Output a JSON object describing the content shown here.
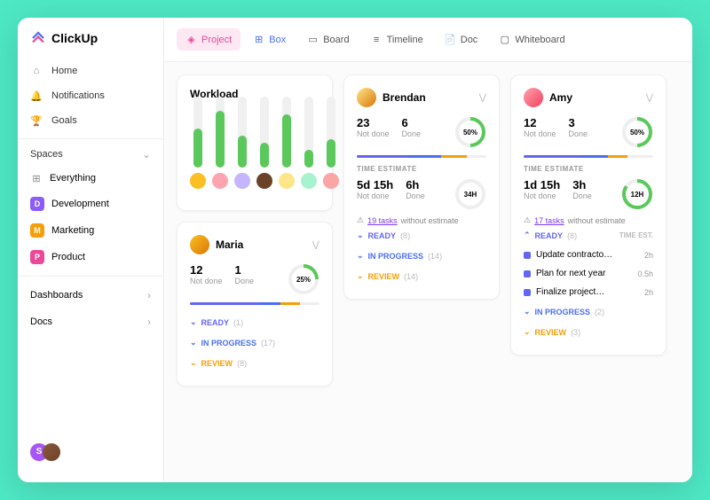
{
  "brand": "ClickUp",
  "sidebar": {
    "nav": [
      {
        "icon": "home",
        "label": "Home"
      },
      {
        "icon": "bell",
        "label": "Notifications"
      },
      {
        "icon": "trophy",
        "label": "Goals"
      }
    ],
    "spaces_label": "Spaces",
    "everything": "Everything",
    "spaces": [
      {
        "letter": "D",
        "color": "#8b5cf6",
        "name": "Development"
      },
      {
        "letter": "M",
        "color": "#f59e0b",
        "name": "Marketing"
      },
      {
        "letter": "P",
        "color": "#ec4899",
        "name": "Product"
      }
    ],
    "dashboards": "Dashboards",
    "docs": "Docs"
  },
  "topbar": {
    "project": "Project",
    "views": [
      {
        "icon": "box",
        "label": "Box",
        "selected": true
      },
      {
        "icon": "board",
        "label": "Board"
      },
      {
        "icon": "timeline",
        "label": "Timeline"
      },
      {
        "icon": "doc",
        "label": "Doc"
      },
      {
        "icon": "whiteboard",
        "label": "Whiteboard"
      }
    ]
  },
  "workload": {
    "title": "Workload",
    "bars": [
      55,
      80,
      45,
      35,
      75,
      25,
      40
    ]
  },
  "people": {
    "maria": {
      "name": "Maria",
      "not_done": {
        "num": "12",
        "label": "Not done"
      },
      "done": {
        "num": "1",
        "label": "Done"
      },
      "ring": {
        "pct": 25,
        "text": "25%",
        "color": "#5ac85a"
      },
      "groups": {
        "ready": {
          "label": "READY",
          "count": "(1)"
        },
        "progress": {
          "label": "IN PROGRESS",
          "count": "(17)"
        },
        "review": {
          "label": "REVIEW",
          "count": "(8)"
        }
      }
    },
    "brendan": {
      "name": "Brendan",
      "not_done": {
        "num": "23",
        "label": "Not done"
      },
      "done": {
        "num": "6",
        "label": "Done"
      },
      "ring": {
        "pct": 50,
        "text": "50%",
        "color": "#5ac85a"
      },
      "time_label": "TIME ESTIMATE",
      "t_not_done": {
        "num": "5d 15h",
        "label": "Not done"
      },
      "t_done": {
        "num": "6h",
        "label": "Done"
      },
      "ring2": {
        "pct": 100,
        "text": "34H",
        "color": "#ddd"
      },
      "warn_count": "19 tasks",
      "warn_rest": " without estimate",
      "groups": {
        "ready": {
          "label": "READY",
          "count": "(8)"
        },
        "progress": {
          "label": "IN PROGRESS",
          "count": "(14)"
        },
        "review": {
          "label": "REVIEW",
          "count": "(14)"
        }
      }
    },
    "amy": {
      "name": "Amy",
      "not_done": {
        "num": "12",
        "label": "Not done"
      },
      "done": {
        "num": "3",
        "label": "Done"
      },
      "ring": {
        "pct": 50,
        "text": "50%",
        "color": "#5ac85a"
      },
      "time_label": "TIME ESTIMATE",
      "t_not_done": {
        "num": "1d 15h",
        "label": "Not done"
      },
      "t_done": {
        "num": "3h",
        "label": "Done"
      },
      "ring2": {
        "pct": 85,
        "text": "12H",
        "color": "#5ac85a"
      },
      "warn_count": "17 tasks",
      "warn_rest": " without estimate",
      "time_est": "TIME EST.",
      "groups": {
        "ready": {
          "label": "READY",
          "count": "(8)"
        },
        "progress": {
          "label": "IN PROGRESS",
          "count": "(2)"
        },
        "review": {
          "label": "REVIEW",
          "count": "(3)"
        }
      },
      "tasks": [
        {
          "name": "Update contracto…",
          "time": "2h"
        },
        {
          "name": "Plan for next year",
          "time": "0.5h"
        },
        {
          "name": "Finalize project…",
          "time": "2h"
        }
      ]
    }
  }
}
